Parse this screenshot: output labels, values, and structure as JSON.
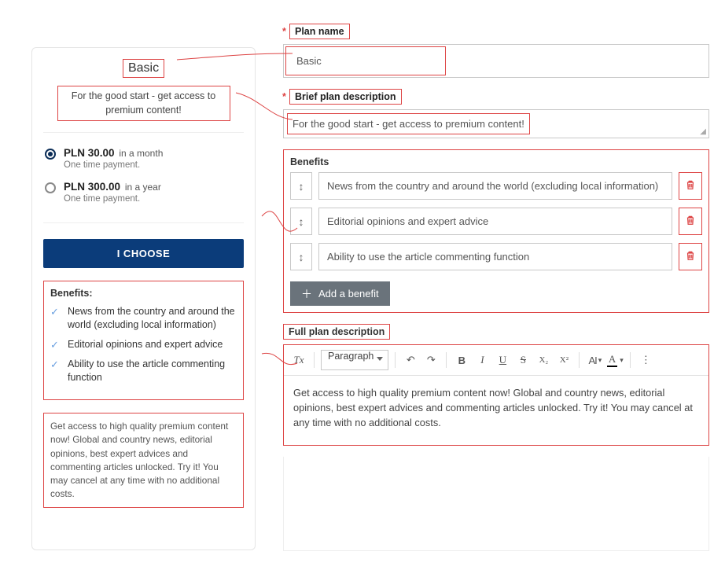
{
  "preview": {
    "title": "Basic",
    "description": "For the good start - get access to premium content!",
    "price_options": [
      {
        "selected": true,
        "currency": "PLN",
        "amount": "30.00",
        "period": "in a month",
        "note": "One time payment."
      },
      {
        "selected": false,
        "currency": "PLN",
        "amount": "300.00",
        "period": "in a year",
        "note": "One time payment."
      }
    ],
    "choose_label": "I CHOOSE",
    "benefits_heading": "Benefits:",
    "benefits": [
      "News from the country and around the world (excluding local information)",
      "Editorial opinions and expert advice",
      "Ability to use the article commenting function"
    ],
    "full_description": "Get access to high quality premium content now! Global and country news, editorial opinions, best expert advices and commenting articles unlocked. Try it! You may cancel at any time with no additional costs."
  },
  "form": {
    "plan_name": {
      "label": "Plan name",
      "value": "Basic"
    },
    "brief": {
      "label": "Brief plan description",
      "value": "For the good start - get access to premium content!"
    },
    "benefits": {
      "heading": "Benefits",
      "items": [
        "News from the country and around the world (excluding local information)",
        "Editorial opinions and expert advice",
        "Ability to use the article commenting function"
      ],
      "add_label": "Add a benefit"
    },
    "full": {
      "heading": "Full plan description",
      "toolbar": {
        "clear_format": "Tx",
        "block_style": "Paragraph",
        "undo": "↶",
        "redo": "↷",
        "bold": "B",
        "italic": "I",
        "underline": "U",
        "strike": "S",
        "subscript": "X₂",
        "superscript": "X²",
        "ai": "AI",
        "color": "A",
        "more": "⋮"
      },
      "body": "Get access to high quality premium content now! Global and country news, editorial opinions, best expert advices and commenting articles unlocked. Try it! You may cancel at any time with no additional costs."
    }
  }
}
